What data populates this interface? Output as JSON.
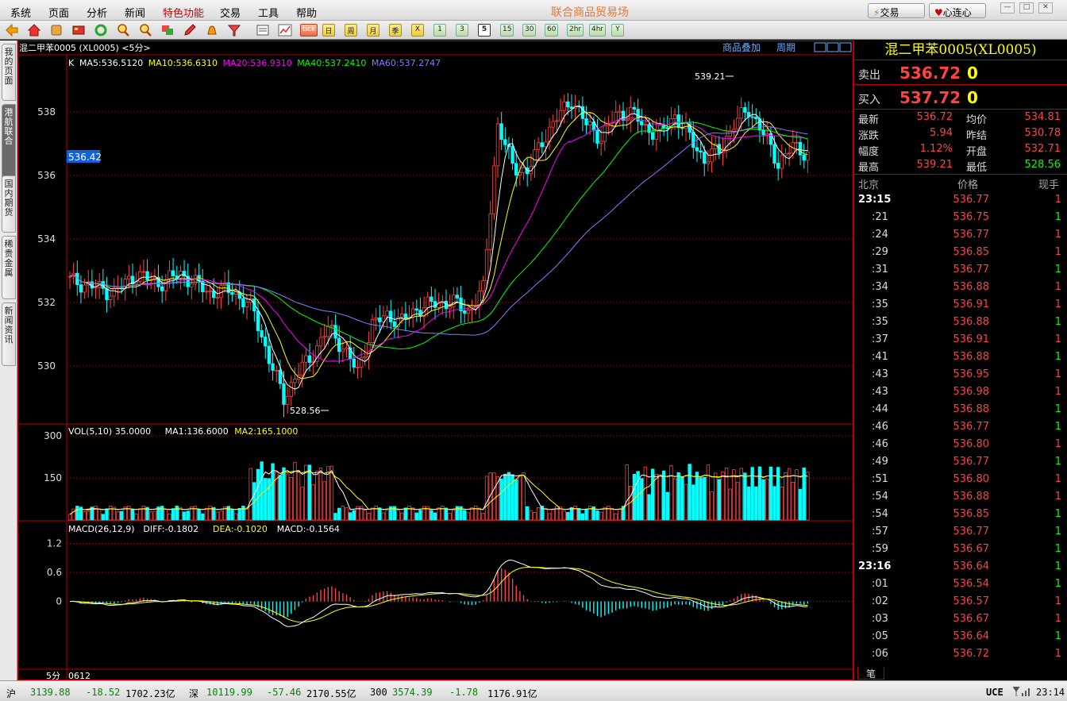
{
  "menu": [
    "系统",
    "页面",
    "分析",
    "新闻",
    "特色功能",
    "交易",
    "工具",
    "帮助"
  ],
  "menu_highlight": "特色功能",
  "app_title": "联合商品贸易场",
  "btn_trade": "交易",
  "btn_connect": "心连心",
  "toolbar_periods": [
    "tick",
    "日",
    "周",
    "月",
    "季",
    "X",
    "1",
    "3",
    "5",
    "15",
    "30",
    "60",
    "2hr",
    "4hr",
    "Y"
  ],
  "active_period": "5",
  "left_tabs": [
    "我的页面",
    "港航联合",
    "国内期货",
    "稀贵金属",
    "新闻资讯"
  ],
  "left_active": "港航联合",
  "chart": {
    "header": "混二甲苯0005 (XL0005) <5分>",
    "link_overlay": "商品叠加",
    "link_period": "周期",
    "ma_line": {
      "k": "K",
      "ma5": "MA5:536.5120",
      "ma10": "MA10:536.6310",
      "ma20": "MA20:536.9310",
      "ma40": "MA40:537.2410",
      "ma60": "MA60:537.2747"
    },
    "price_ticks": [
      "538",
      "536",
      "534",
      "532",
      "530"
    ],
    "crosshair_value": "536.42",
    "high_label": "539.21",
    "low_label": "528.56",
    "vol_line": {
      "title": "VOL(5,10) 35.0000",
      "ma1": "MA1:136.6000",
      "ma2": "MA2:165.1000"
    },
    "vol_ticks": [
      "300",
      "150"
    ],
    "macd_line": {
      "title": "MACD(26,12,9)",
      "diff": "DIFF:-0.1802",
      "dea": "DEA:-0.1020",
      "macd": "MACD:-0.1564"
    },
    "macd_ticks": [
      "1.2",
      "0.6",
      "0"
    ],
    "period_label": "5分",
    "time_label": "0612",
    "colors": {
      "up": "#ff4242",
      "down": "#00ffff",
      "ma5": "#ffffff",
      "ma10": "#ffff00",
      "ma20": "#ff00ff",
      "ma40": "#00ff00",
      "ma60": "#7f7fff",
      "grid": "#8b0000"
    }
  },
  "quote": {
    "title": "混二甲苯0005(XL0005)",
    "sell_label": "卖出",
    "sell_price": "536.72",
    "sell_vol": "0",
    "buy_label": "买入",
    "buy_price": "537.72",
    "buy_vol": "0",
    "stats": [
      {
        "l": "最新",
        "v": "536.72",
        "l2": "均价",
        "v2": "534.81"
      },
      {
        "l": "涨跌",
        "v": "5.94",
        "l2": "昨结",
        "v2": "530.78"
      },
      {
        "l": "幅度",
        "v": "1.12%",
        "l2": "开盘",
        "v2": "532.71"
      },
      {
        "l": "最高",
        "v": "539.21",
        "l2": "最低",
        "v2": "528.56"
      }
    ],
    "tick_header": {
      "t": "北京",
      "p": "价格",
      "v": "现手"
    },
    "ticks": [
      [
        "23:15",
        "536.77",
        "1",
        "r"
      ],
      [
        ":21",
        "536.75",
        "1",
        "g"
      ],
      [
        ":24",
        "536.77",
        "1",
        "r"
      ],
      [
        ":29",
        "536.85",
        "1",
        "r"
      ],
      [
        ":31",
        "536.77",
        "1",
        "g"
      ],
      [
        ":34",
        "536.88",
        "1",
        "r"
      ],
      [
        ":35",
        "536.91",
        "1",
        "r"
      ],
      [
        ":35",
        "536.88",
        "1",
        "g"
      ],
      [
        ":37",
        "536.91",
        "1",
        "r"
      ],
      [
        ":41",
        "536.88",
        "1",
        "g"
      ],
      [
        ":43",
        "536.95",
        "1",
        "r"
      ],
      [
        ":43",
        "536.98",
        "1",
        "r"
      ],
      [
        ":44",
        "536.88",
        "1",
        "g"
      ],
      [
        ":46",
        "536.77",
        "1",
        "g"
      ],
      [
        ":46",
        "536.80",
        "1",
        "r"
      ],
      [
        ":49",
        "536.77",
        "1",
        "g"
      ],
      [
        ":51",
        "536.80",
        "1",
        "r"
      ],
      [
        ":54",
        "536.88",
        "1",
        "r"
      ],
      [
        ":54",
        "536.85",
        "1",
        "g"
      ],
      [
        ":57",
        "536.77",
        "1",
        "g"
      ],
      [
        ":59",
        "536.67",
        "1",
        "g"
      ],
      [
        "23:16",
        "536.64",
        "1",
        "g"
      ],
      [
        ":01",
        "536.54",
        "1",
        "g"
      ],
      [
        ":02",
        "536.57",
        "1",
        "r"
      ],
      [
        ":03",
        "536.67",
        "1",
        "r"
      ],
      [
        ":05",
        "536.64",
        "1",
        "g"
      ],
      [
        ":06",
        "536.72",
        "1",
        "r"
      ]
    ],
    "tab": "笔"
  },
  "status": {
    "sh_label": "沪",
    "sh_index": "3139.88",
    "sh_change": "-18.52",
    "sh_amount": "1702.23亿",
    "sz_label": "深",
    "sz_index": "10119.99",
    "sz_change": "-57.46",
    "sz_amount": "2170.55亿",
    "h300_label": "300",
    "h300_index": "3574.39",
    "h300_change": "-1.78",
    "h300_amount": "1176.91亿",
    "uce": "UCE",
    "time": "23:14"
  }
}
